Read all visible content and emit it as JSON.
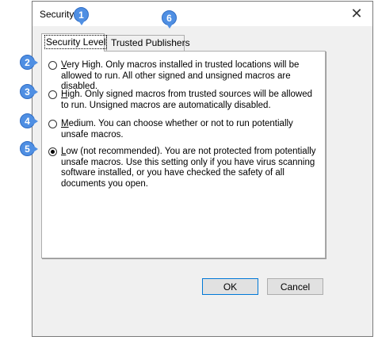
{
  "window": {
    "title": "Security",
    "close_icon": "close-icon"
  },
  "tabs": [
    {
      "label": "Security Level",
      "active": true
    },
    {
      "label": "Trusted Publishers",
      "active": false
    }
  ],
  "options": [
    {
      "mnemonic": "V",
      "rest": "ery High. Only macros installed in trusted locations will be allowed to run. All other signed and unsigned macros are disabled.",
      "selected": false
    },
    {
      "mnemonic": "H",
      "rest": "igh. Only signed macros from trusted sources will be allowed to run. Unsigned macros are automatically disabled.",
      "selected": false
    },
    {
      "mnemonic": "M",
      "rest": "edium. You can choose whether or not to run potentially unsafe macros.",
      "selected": false
    },
    {
      "mnemonic": "L",
      "rest": "ow (not recommended). You are not protected from potentially unsafe macros. Use this setting only if you have virus scanning software installed, or you have checked the safety of all documents you open.",
      "selected": true
    }
  ],
  "buttons": {
    "ok": "OK",
    "cancel": "Cancel"
  },
  "callouts": [
    "1",
    "6",
    "2",
    "3",
    "4",
    "5"
  ],
  "colors": {
    "callout": "#4f8fe3",
    "default_button_border": "#0078d7"
  }
}
